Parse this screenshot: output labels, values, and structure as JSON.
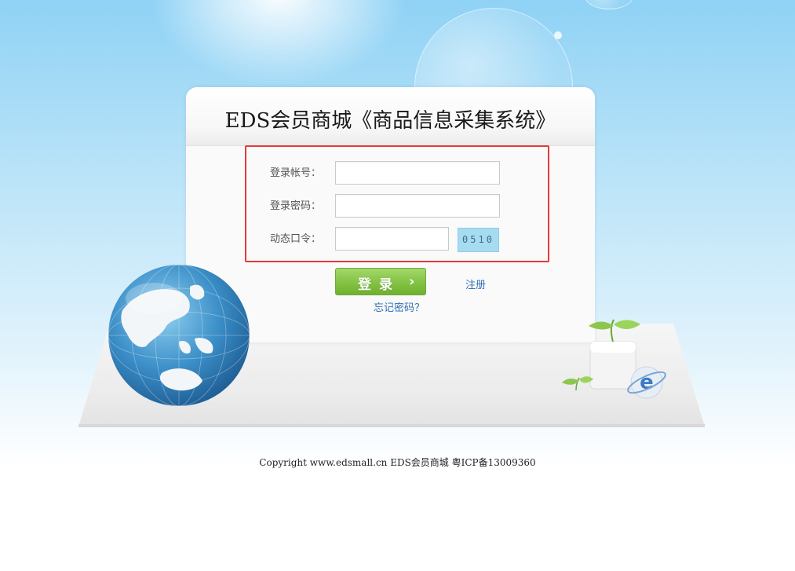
{
  "title": "EDS会员商城《商品信息采集系统》",
  "form": {
    "account_label": "登录帐号：",
    "account_value": "",
    "password_label": "登录密码：",
    "password_value": "",
    "dynamic_label": "动态口令：",
    "dynamic_value": "",
    "captcha_text": "0510"
  },
  "actions": {
    "login_label": "登录",
    "register_label": "注册",
    "forgot_label": "忘记密码？"
  },
  "footer": {
    "text": "Copyright www.edsmall.cn EDS会员商城 粤ICP备13009360"
  },
  "colors": {
    "sky_top": "#8fd2f5",
    "highlight_border": "#e23b3b",
    "login_button": "#85c446",
    "link": "#2f6fb3"
  },
  "icons": {
    "login_arrow": "chevron-right-icon",
    "globe": "globe-icon",
    "plant": "plant-cube-icon",
    "browser_e": "e-logo-icon"
  }
}
